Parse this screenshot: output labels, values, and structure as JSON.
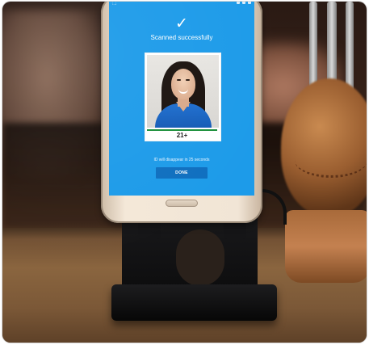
{
  "scene": {
    "description_colors": {
      "screen": "#1d9be9",
      "button": "#0f6fbf",
      "badge_rule": "#1a8f3a"
    }
  },
  "phone_screen": {
    "status_time": "",
    "check_icon": "checkmark-icon",
    "title": "Scanned successfully",
    "age_badge": "21+",
    "disappear_text": "ID will disappear in 25 seconds",
    "done_label": "DONE"
  }
}
